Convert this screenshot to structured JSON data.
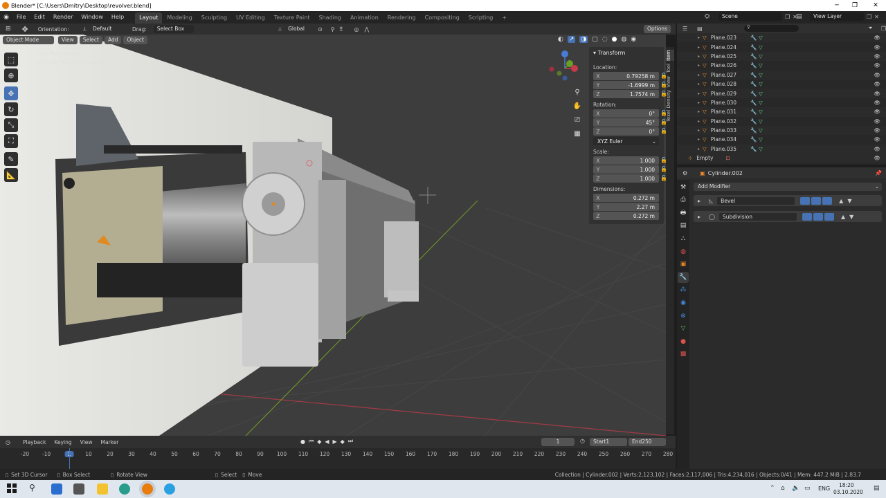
{
  "window": {
    "title": "Blender* [C:\\Users\\Dmitry\\Desktop\\revolver.blend]"
  },
  "menu": [
    "File",
    "Edit",
    "Render",
    "Window",
    "Help"
  ],
  "workspaces": [
    "Layout",
    "Modeling",
    "Sculpting",
    "UV Editing",
    "Texture Paint",
    "Shading",
    "Animation",
    "Rendering",
    "Compositing",
    "Scripting"
  ],
  "active_workspace": "Layout",
  "scene": {
    "label": "Scene",
    "view_layer": "View Layer"
  },
  "header": {
    "orientation_label": "Orientation:",
    "orientation_value": "Default",
    "drag_label": "Drag:",
    "drag_value": "Select Box",
    "transform_orientation": "Global",
    "options": "Options"
  },
  "viewport_header": {
    "mode": "Object Mode",
    "menus": [
      "View",
      "Select",
      "Add",
      "Object"
    ]
  },
  "viewport_overlay": {
    "line1": "User Perspective",
    "line2": "(1) Collection | Cylinder.002"
  },
  "npanel": {
    "title": "Transform",
    "location_label": "Location:",
    "location": [
      {
        "axis": "X",
        "value": "0.79258 m"
      },
      {
        "axis": "Y",
        "value": "-1.6999 m"
      },
      {
        "axis": "Z",
        "value": "1.7574 m"
      }
    ],
    "rotation_label": "Rotation:",
    "rotation": [
      {
        "axis": "X",
        "value": "0°"
      },
      {
        "axis": "Y",
        "value": "45°"
      },
      {
        "axis": "Z",
        "value": "0°"
      }
    ],
    "rotation_mode": "XYZ Euler",
    "scale_label": "Scale:",
    "scale": [
      {
        "axis": "X",
        "value": "1.000"
      },
      {
        "axis": "Y",
        "value": "1.000"
      },
      {
        "axis": "Z",
        "value": "1.000"
      }
    ],
    "dimensions_label": "Dimensions:",
    "dimensions": [
      {
        "axis": "X",
        "value": "0.272 m"
      },
      {
        "axis": "Y",
        "value": "2.27 m"
      },
      {
        "axis": "Z",
        "value": "0.272 m"
      }
    ]
  },
  "side_tabs": [
    "Item",
    "Tool",
    "View",
    "Texel Density"
  ],
  "outliner": {
    "items": [
      "Plane.023",
      "Plane.024",
      "Plane.025",
      "Plane.026",
      "Plane.027",
      "Plane.028",
      "Plane.029",
      "Plane.030",
      "Plane.031",
      "Plane.032",
      "Plane.033",
      "Plane.034",
      "Plane.035"
    ],
    "empty": "Empty"
  },
  "properties": {
    "object": "Cylinder.002",
    "add_modifier": "Add Modifier",
    "modifiers": [
      "Bevel",
      "Subdivision"
    ]
  },
  "timeline": {
    "menus": [
      "Playback",
      "Keying",
      "View",
      "Marker"
    ],
    "current_frame": "1",
    "start_label": "Start",
    "start": "1",
    "end_label": "End",
    "end": "250",
    "ruler": [
      "-20",
      "-10",
      "1",
      "10",
      "20",
      "30",
      "40",
      "50",
      "60",
      "70",
      "80",
      "90",
      "100",
      "110",
      "120",
      "130",
      "140",
      "150",
      "160",
      "170",
      "180",
      "190",
      "200",
      "210",
      "220",
      "230",
      "240",
      "250",
      "260",
      "270",
      "280"
    ]
  },
  "status": {
    "hints": [
      "Set 3D Cursor",
      "Box Select",
      "Rotate View",
      "Select",
      "Move"
    ],
    "stats": "Collection | Cylinder.002 | Verts:2,123,102 | Faces:2,117,006 | Tris:4,234,016 | Objects:0/41 | Mem: 447.2 MiB | 2.83.7"
  },
  "taskbar": {
    "lang": "ENG",
    "time": "18:20",
    "date": "03.10.2020"
  }
}
